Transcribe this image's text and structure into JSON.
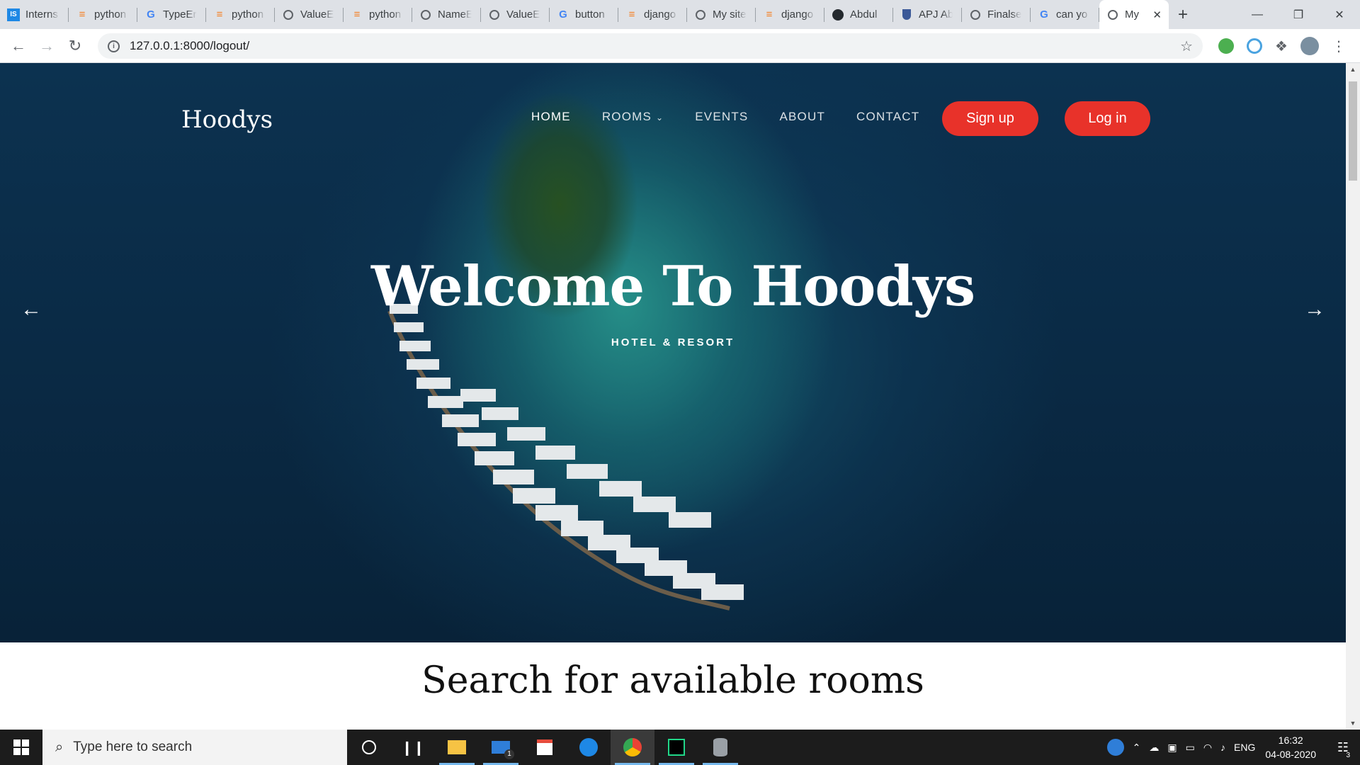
{
  "browser": {
    "tabs": [
      {
        "title": "Interns",
        "icon": "internshala-icon"
      },
      {
        "title": "python",
        "icon": "stackoverflow-icon"
      },
      {
        "title": "TypeEr",
        "icon": "google-icon"
      },
      {
        "title": "python",
        "icon": "stackoverflow-icon"
      },
      {
        "title": "ValueE",
        "icon": "globe-icon"
      },
      {
        "title": "python",
        "icon": "stackoverflow-icon"
      },
      {
        "title": "NameE",
        "icon": "globe-icon"
      },
      {
        "title": "ValueE",
        "icon": "globe-icon"
      },
      {
        "title": "button",
        "icon": "google-icon"
      },
      {
        "title": "django",
        "icon": "stackoverflow-icon"
      },
      {
        "title": "My site",
        "icon": "globe-icon"
      },
      {
        "title": "django",
        "icon": "stackoverflow-icon"
      },
      {
        "title": "Abdul",
        "icon": "github-icon"
      },
      {
        "title": "APJ Ab",
        "icon": "shield-icon"
      },
      {
        "title": "Finalse",
        "icon": "globe-icon"
      },
      {
        "title": "can yo",
        "icon": "google-icon"
      },
      {
        "title": "My",
        "icon": "globe-icon",
        "active": true
      }
    ],
    "url": "127.0.0.1:8000/logout/"
  },
  "site": {
    "brand": "Hoodys",
    "nav": {
      "home": "HOME",
      "rooms": "ROOMS",
      "events": "EVENTS",
      "about": "ABOUT",
      "contact": "CONTACT"
    },
    "signup": "Sign up",
    "login": "Log in",
    "hero_title": "Welcome To Hoodys",
    "hero_subtitle": "HOTEL & RESORT",
    "search_title": "Search for available rooms",
    "accent": "#e8322a"
  },
  "taskbar": {
    "search_placeholder": "Type here to search",
    "lang": "ENG",
    "time": "16:32",
    "date": "04-08-2020",
    "notif_count": "3",
    "mail_badge": "1"
  }
}
